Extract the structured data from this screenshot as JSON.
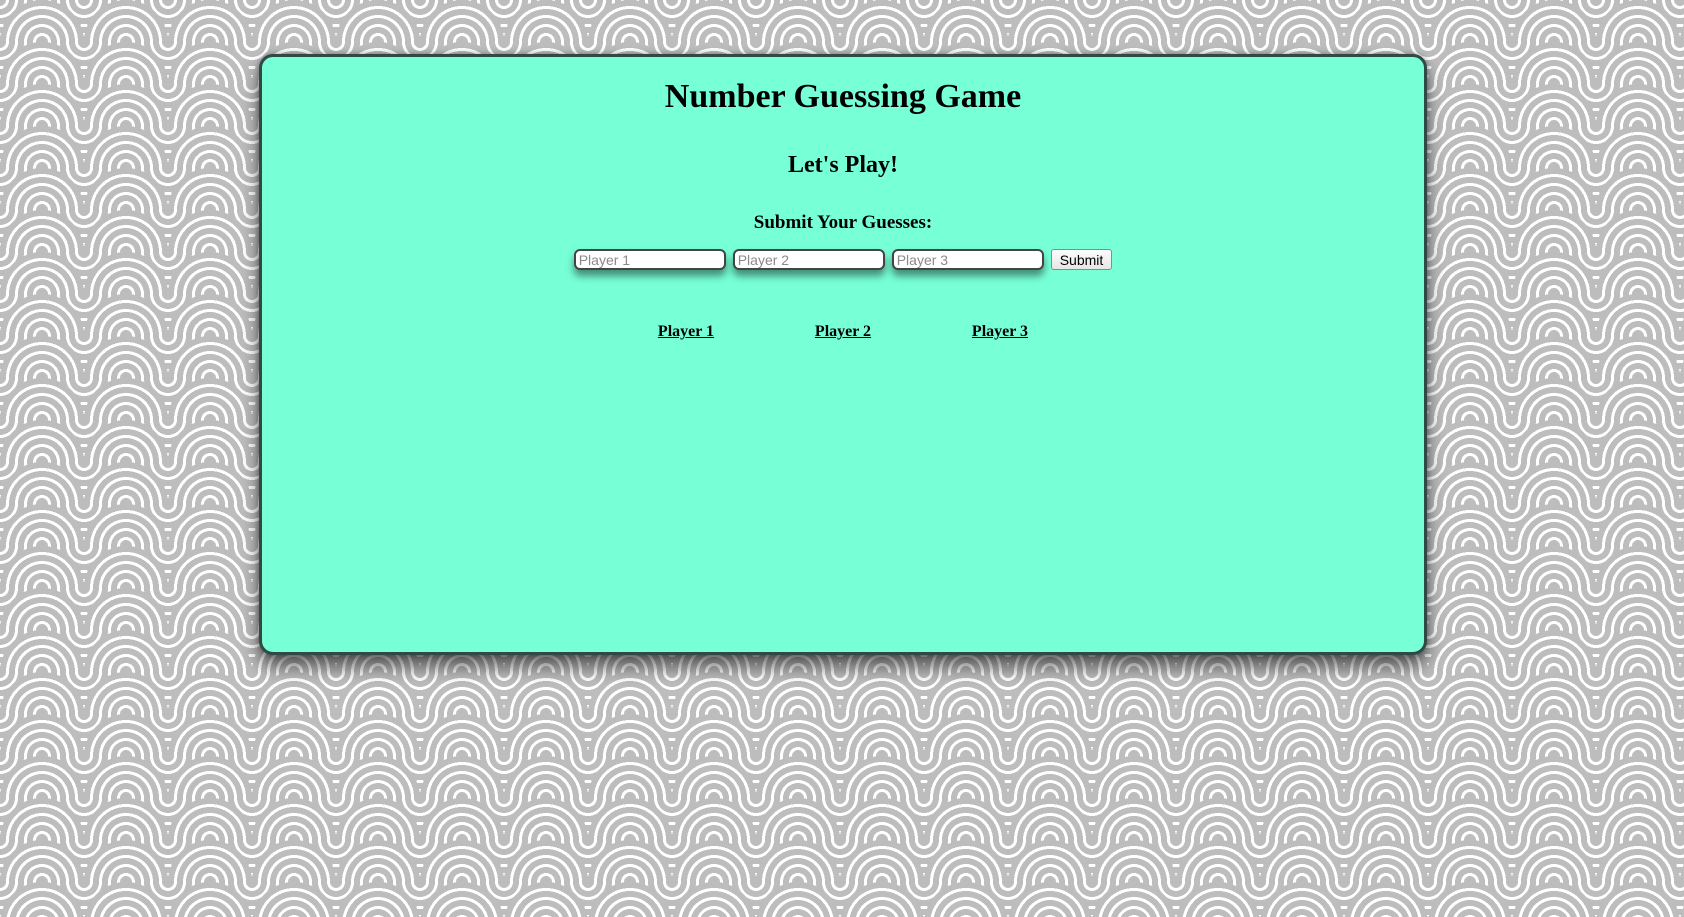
{
  "game": {
    "title": "Number Guessing Game",
    "subtitle": "Let's Play!",
    "prompt": "Submit Your Guesses:"
  },
  "form": {
    "inputs": [
      {
        "placeholder": "Player 1",
        "value": ""
      },
      {
        "placeholder": "Player 2",
        "value": ""
      },
      {
        "placeholder": "Player 3",
        "value": ""
      }
    ],
    "submit_label": "Submit"
  },
  "players": [
    {
      "label": "Player 1"
    },
    {
      "label": "Player 2"
    },
    {
      "label": "Player 3"
    }
  ],
  "colors": {
    "panel_background": "#77ffd6",
    "panel_border": "#2f4a44",
    "pattern_gray": "#bdbdbd"
  }
}
